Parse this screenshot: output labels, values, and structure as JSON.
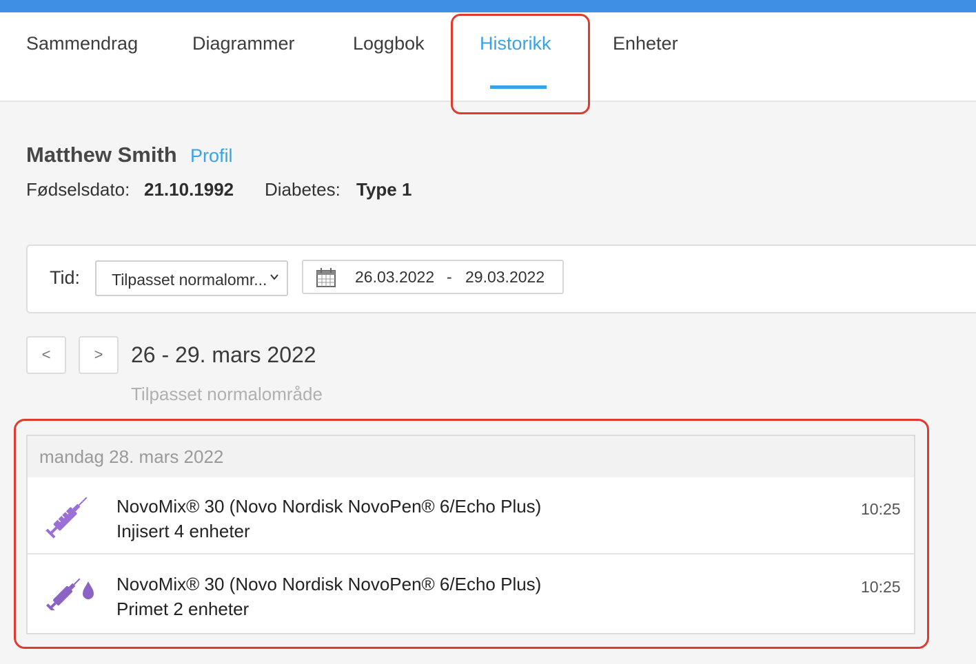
{
  "colors": {
    "accent": "#3aa3e8",
    "top_bar": "#3f8fe5",
    "highlight": "#e03a2f",
    "insulin_icon": "#9b6fd6"
  },
  "nav": {
    "tabs": [
      {
        "label": "Sammendrag"
      },
      {
        "label": "Diagrammer"
      },
      {
        "label": "Loggbok"
      },
      {
        "label": "Historikk",
        "active": true
      },
      {
        "label": "Enheter"
      }
    ]
  },
  "patient": {
    "name": "Matthew Smith",
    "profile_link": "Profil",
    "dob_label": "Fødselsdato:",
    "dob_value": "21.10.1992",
    "diabetes_label": "Diabetes:",
    "diabetes_value": "Type 1"
  },
  "filter": {
    "time_label": "Tid:",
    "range_select": "Tilpasset normalomr...",
    "date_from": "26.03.2022",
    "date_separator": "-",
    "date_to": "29.03.2022",
    "icons": {
      "calendar": "calendar-icon",
      "select": "chevron-down-icon"
    }
  },
  "period": {
    "prev_label": "<",
    "next_label": ">",
    "title": "26 - 29. mars 2022",
    "subtitle": "Tilpasset normalområde"
  },
  "history": {
    "day_label": "mandag 28. mars 2022",
    "entries": [
      {
        "icon": "syringe-icon",
        "title": "NovoMix® 30 (Novo Nordisk NovoPen® 6/Echo Plus)",
        "detail": "Injisert 4 enheter",
        "time": "10:25"
      },
      {
        "icon": "syringe-drop-icon",
        "title": "NovoMix® 30 (Novo Nordisk NovoPen® 6/Echo Plus)",
        "detail": "Primet 2 enheter",
        "time": "10:25"
      }
    ]
  }
}
